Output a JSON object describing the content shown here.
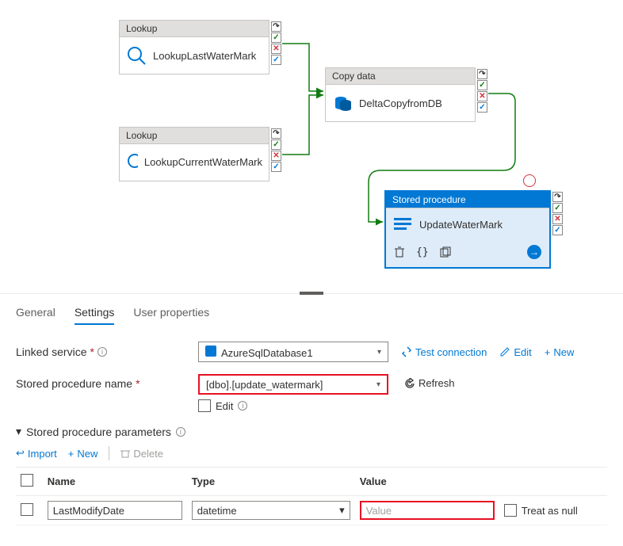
{
  "canvas": {
    "lookup1": {
      "type": "Lookup",
      "name": "LookupLastWaterMark"
    },
    "lookup2": {
      "type": "Lookup",
      "name": "LookupCurrentWaterMark"
    },
    "copy": {
      "type": "Copy data",
      "name": "DeltaCopyfromDB"
    },
    "sp": {
      "type": "Stored procedure",
      "name": "UpdateWaterMark"
    }
  },
  "tabs": {
    "general": "General",
    "settings": "Settings",
    "user_props": "User properties"
  },
  "linked_service": {
    "label": "Linked service",
    "value": "AzureSqlDatabase1",
    "test": "Test connection",
    "edit": "Edit",
    "new": "New"
  },
  "sp_name": {
    "label": "Stored procedure name",
    "value": "[dbo].[update_watermark]",
    "refresh": "Refresh",
    "edit": "Edit"
  },
  "params": {
    "header": "Stored procedure parameters",
    "import": "Import",
    "new": "New",
    "delete": "Delete",
    "cols": {
      "name": "Name",
      "type": "Type",
      "value": "Value"
    },
    "rows": [
      {
        "name": "LastModifyDate",
        "type": "datetime",
        "value": "",
        "placeholder": "Value",
        "null_label": "Treat as null"
      }
    ]
  }
}
